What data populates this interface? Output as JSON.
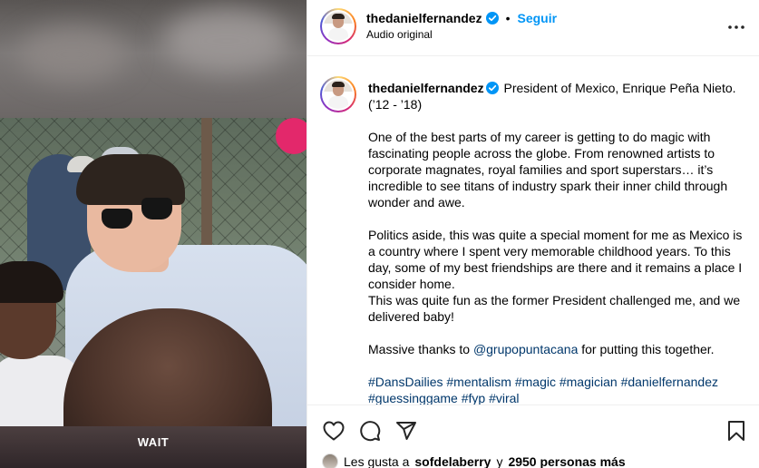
{
  "video": {
    "caption_overlay": "WAIT"
  },
  "post_header": {
    "username": "thedanielfernandez",
    "separator": "•",
    "follow_label": "Seguir",
    "audio_label": "Audio original",
    "more_icon": "more-horizontal-icon"
  },
  "caption": {
    "username": "thedanielfernandez",
    "title_line": "President of Mexico, Enrique Peña Nieto.",
    "title_years": "(’12 - ’18)",
    "paragraph1": "One of the best parts of my career is getting to do magic with fascinating people across the globe. From renowned artists to corporate magnates, royal families and sport superstars… it’s incredible to see titans of industry spark their inner child through wonder and awe.",
    "paragraph2": "Politics aside, this was quite a special moment for me as Mexico is a country where I spent very memorable childhood years. To this day, some of my best friendships are there and it remains a place I consider home.",
    "paragraph3": "This was quite fun as the former President challenged me, and we delivered baby!",
    "thanks_prefix": "Massive thanks to ",
    "thanks_mention": "@grupopuntacana",
    "thanks_suffix": " for putting this together.",
    "hashtags_line1": "#DansDailies #mentalism #magic #magician #danielfernandez",
    "hashtags_line2": "#guessinggame #fyp #viral"
  },
  "actions": {
    "like_icon": "heart-icon",
    "comment_icon": "comment-icon",
    "share_icon": "send-icon",
    "save_icon": "bookmark-icon"
  },
  "likes": {
    "prefix": "Les gusta a",
    "user": "sofdelaberry",
    "connector": "y",
    "count_text": "2950 personas más"
  },
  "colors": {
    "accent": "#0095f6",
    "link": "#00376b",
    "verified": "#0095f6"
  }
}
